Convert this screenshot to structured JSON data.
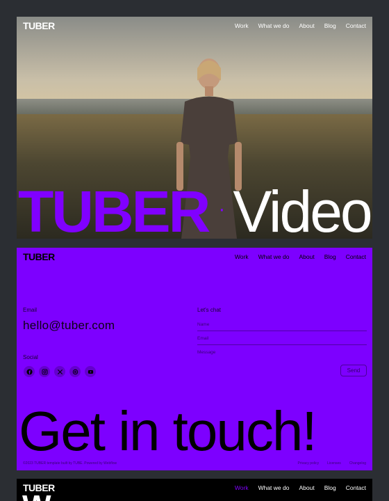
{
  "nav": {
    "logo": "TUBER",
    "items": [
      "Work",
      "What we do",
      "About",
      "Blog",
      "Contact"
    ]
  },
  "hero": {
    "brand": "TUBER",
    "separator": "·",
    "word": "Video"
  },
  "contact": {
    "email_label": "Email",
    "email": "hello@tuber.com",
    "social_label": "Social",
    "chat_label": "Let's chat",
    "name_placeholder": "Name",
    "email_placeholder": "Email",
    "message_placeholder": "Message",
    "send_label": "Send",
    "headline": "Get in touch!",
    "footer_left": "©2023 TUBER template built by TUBE. Powered by Webflow",
    "footer_links": [
      "Privacy policy",
      "Licenses",
      "Changelog"
    ],
    "socials": [
      "facebook-icon",
      "instagram-icon",
      "x-icon",
      "threads-icon",
      "youtube-icon"
    ]
  },
  "third": {
    "active_item": "Work",
    "headline_partial": "W..."
  },
  "colors": {
    "accent": "#8000ff",
    "contact_bg": "#7d00ff",
    "page_bg": "#2b2e33"
  }
}
